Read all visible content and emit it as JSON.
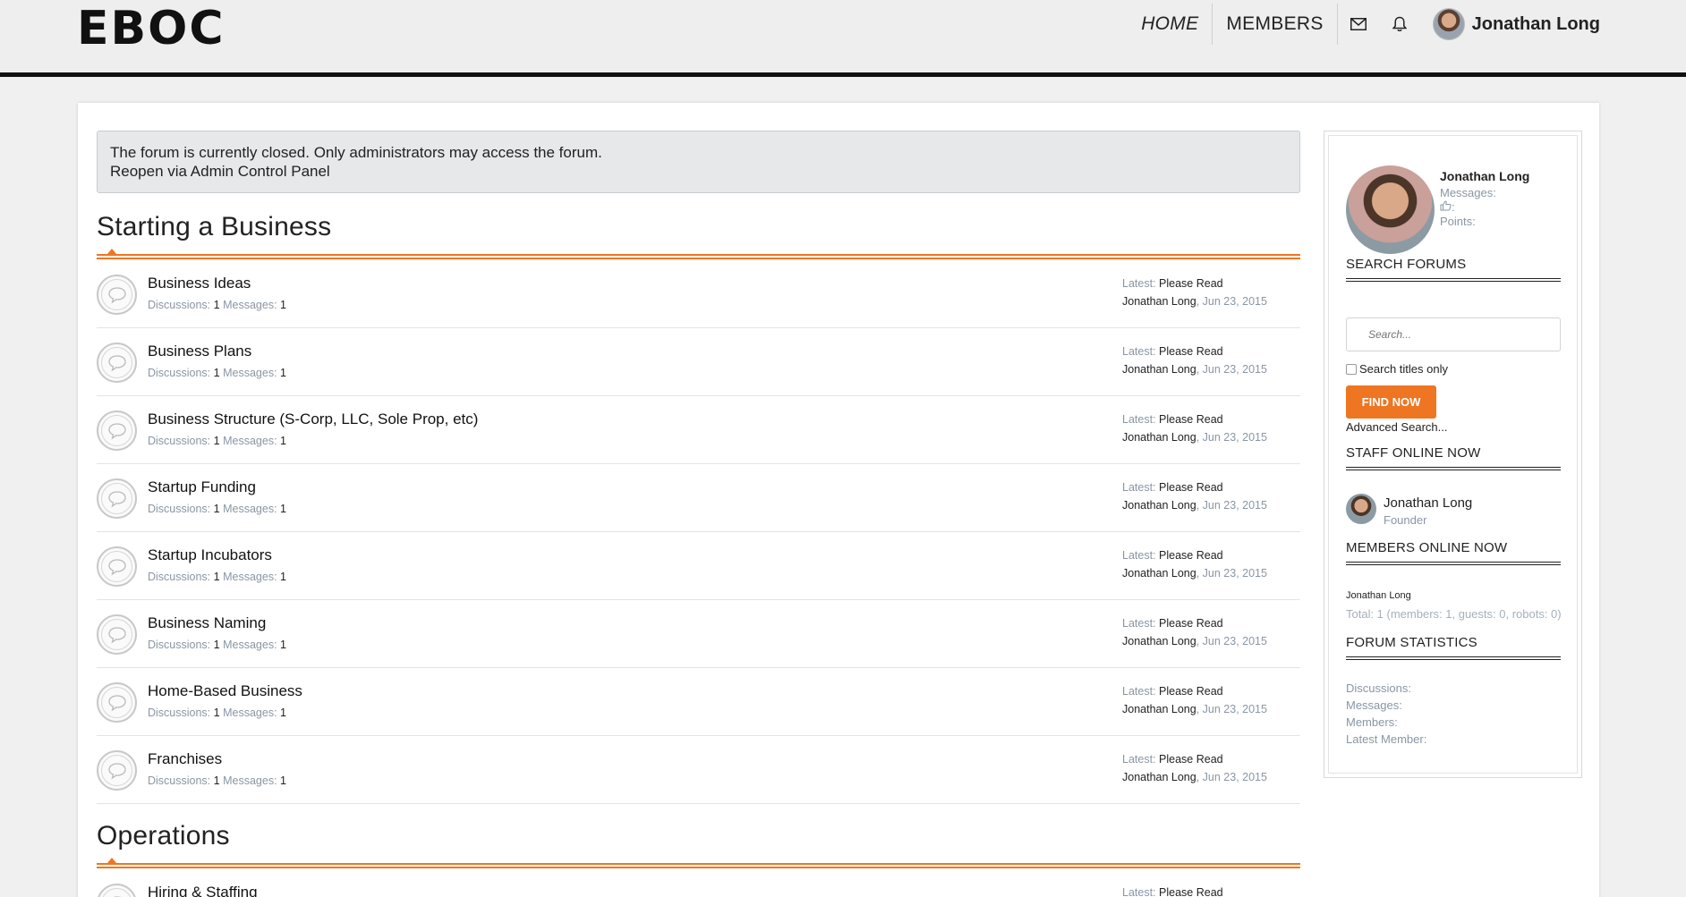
{
  "header": {
    "logo": "EBOC",
    "nav": {
      "home": "HOME",
      "members": "MEMBERS"
    },
    "user_name": "Jonathan Long",
    "icons": [
      "mail-icon",
      "bell-icon"
    ]
  },
  "notice": {
    "line1": "The forum is currently closed. Only administrators may access the forum.",
    "line2": "Reopen via Admin Control Panel"
  },
  "categories": [
    {
      "title": "Starting a Business",
      "forums": [
        {
          "name": "Business Ideas",
          "discussions_label": "Discussions:",
          "discussions": "1",
          "messages_label": "Messages:",
          "messages": "1",
          "latest_label": "Latest:",
          "latest_title": "Please Read",
          "latest_user": "Jonathan Long",
          "latest_date": ", Jun 23, 2015"
        },
        {
          "name": "Business Plans",
          "discussions_label": "Discussions:",
          "discussions": "1",
          "messages_label": "Messages:",
          "messages": "1",
          "latest_label": "Latest:",
          "latest_title": "Please Read",
          "latest_user": "Jonathan Long",
          "latest_date": ", Jun 23, 2015"
        },
        {
          "name": "Business Structure (S-Corp, LLC, Sole Prop, etc)",
          "discussions_label": "Discussions:",
          "discussions": "1",
          "messages_label": "Messages:",
          "messages": "1",
          "latest_label": "Latest:",
          "latest_title": "Please Read",
          "latest_user": "Jonathan Long",
          "latest_date": ", Jun 23, 2015"
        },
        {
          "name": "Startup Funding",
          "discussions_label": "Discussions:",
          "discussions": "1",
          "messages_label": "Messages:",
          "messages": "1",
          "latest_label": "Latest:",
          "latest_title": "Please Read",
          "latest_user": "Jonathan Long",
          "latest_date": ", Jun 23, 2015"
        },
        {
          "name": "Startup Incubators",
          "discussions_label": "Discussions:",
          "discussions": "1",
          "messages_label": "Messages:",
          "messages": "1",
          "latest_label": "Latest:",
          "latest_title": "Please Read",
          "latest_user": "Jonathan Long",
          "latest_date": ", Jun 23, 2015"
        },
        {
          "name": "Business Naming",
          "discussions_label": "Discussions:",
          "discussions": "1",
          "messages_label": "Messages:",
          "messages": "1",
          "latest_label": "Latest:",
          "latest_title": "Please Read",
          "latest_user": "Jonathan Long",
          "latest_date": ", Jun 23, 2015"
        },
        {
          "name": "Home-Based Business",
          "discussions_label": "Discussions:",
          "discussions": "1",
          "messages_label": "Messages:",
          "messages": "1",
          "latest_label": "Latest:",
          "latest_title": "Please Read",
          "latest_user": "Jonathan Long",
          "latest_date": ", Jun 23, 2015"
        },
        {
          "name": "Franchises",
          "discussions_label": "Discussions:",
          "discussions": "1",
          "messages_label": "Messages:",
          "messages": "1",
          "latest_label": "Latest:",
          "latest_title": "Please Read",
          "latest_user": "Jonathan Long",
          "latest_date": ", Jun 23, 2015"
        }
      ]
    },
    {
      "title": "Operations",
      "forums": [
        {
          "name": "Hiring & Staffing",
          "latest_label": "Latest:",
          "latest_title": "Please Read"
        }
      ]
    }
  ],
  "sidebar": {
    "profile": {
      "name": "Jonathan Long",
      "messages_label": "Messages:",
      "likes_icon": "thumbs-up-icon",
      "likes_suffix": ":",
      "points_label": "Points:"
    },
    "search": {
      "heading": "SEARCH FORUMS",
      "placeholder": "Search...",
      "titles_only_label": "Search titles only",
      "button": "FIND NOW",
      "advanced": "Advanced Search..."
    },
    "staff": {
      "heading": "STAFF ONLINE NOW",
      "name": "Jonathan Long",
      "role": "Founder"
    },
    "members_online": {
      "heading": "MEMBERS ONLINE NOW",
      "name": "Jonathan Long",
      "total": "Total: 1 (members: 1, guests: 0, robots: 0)"
    },
    "stats": {
      "heading": "FORUM STATISTICS",
      "discussions_label": "Discussions:",
      "messages_label": "Messages:",
      "members_label": "Members:",
      "latest_member_label": "Latest Member:"
    }
  },
  "colors": {
    "accent": "#ee7623",
    "header_bg": "#eeeeee",
    "muted_text": "#8a96a3"
  }
}
